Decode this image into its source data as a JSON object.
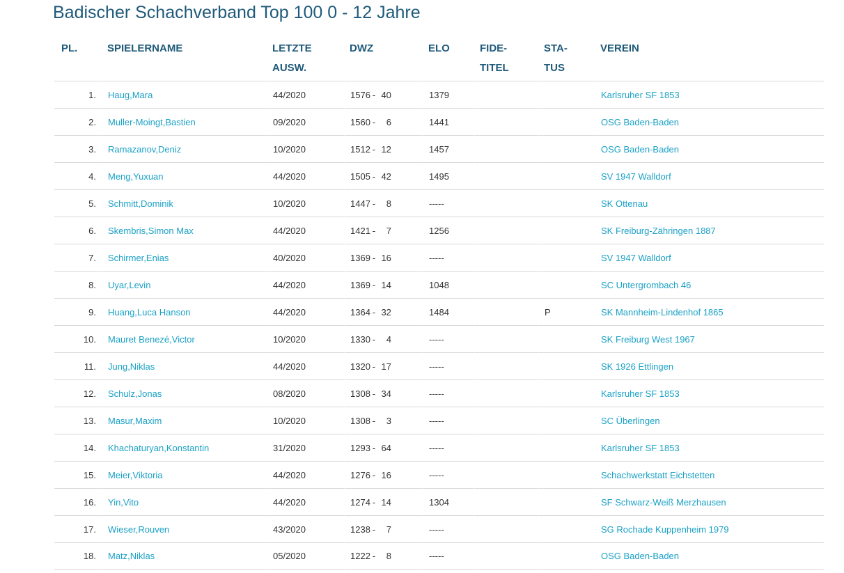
{
  "page": {
    "title": "Badischer Schachverband Top 100 0 - 12 Jahre"
  },
  "table": {
    "headers": {
      "pl": "PL.",
      "name": "SPIELERNAME",
      "auswertung_1": "LETZTE",
      "auswertung_2": "AUSW.",
      "dwz": "DWZ",
      "elo": "ELO",
      "fide_1": "FIDE-",
      "fide_2": "TITEL",
      "status_1": "STA-",
      "status_2": "TUS",
      "verein": "VEREIN"
    },
    "rows": [
      {
        "rank": "1.",
        "name": "Haug,Mara",
        "ausw": "44/2020",
        "dwz": "1576",
        "sep": "-",
        "count": "40",
        "elo": "1379",
        "fide": "",
        "status": "",
        "club": "Karlsruher SF 1853"
      },
      {
        "rank": "2.",
        "name": "Muller-Moingt,Bastien",
        "ausw": "09/2020",
        "dwz": "1560",
        "sep": "-",
        "count": "6",
        "elo": "1441",
        "fide": "",
        "status": "",
        "club": "OSG Baden-Baden"
      },
      {
        "rank": "3.",
        "name": "Ramazanov,Deniz",
        "ausw": "10/2020",
        "dwz": "1512",
        "sep": "-",
        "count": "12",
        "elo": "1457",
        "fide": "",
        "status": "",
        "club": "OSG Baden-Baden"
      },
      {
        "rank": "4.",
        "name": "Meng,Yuxuan",
        "ausw": "44/2020",
        "dwz": "1505",
        "sep": "-",
        "count": "42",
        "elo": "1495",
        "fide": "",
        "status": "",
        "club": "SV 1947 Walldorf"
      },
      {
        "rank": "5.",
        "name": "Schmitt,Dominik",
        "ausw": "10/2020",
        "dwz": "1447",
        "sep": "-",
        "count": "8",
        "elo": "-----",
        "fide": "",
        "status": "",
        "club": "SK Ottenau"
      },
      {
        "rank": "6.",
        "name": "Skembris,Simon Max",
        "ausw": "44/2020",
        "dwz": "1421",
        "sep": "-",
        "count": "7",
        "elo": "1256",
        "fide": "",
        "status": "",
        "club": "SK Freiburg-Zähringen 1887"
      },
      {
        "rank": "7.",
        "name": "Schirmer,Enias",
        "ausw": "40/2020",
        "dwz": "1369",
        "sep": "-",
        "count": "16",
        "elo": "-----",
        "fide": "",
        "status": "",
        "club": "SV 1947 Walldorf"
      },
      {
        "rank": "8.",
        "name": "Uyar,Levin",
        "ausw": "44/2020",
        "dwz": "1369",
        "sep": "-",
        "count": "14",
        "elo": "1048",
        "fide": "",
        "status": "",
        "club": "SC Untergrombach 46"
      },
      {
        "rank": "9.",
        "name": "Huang,Luca Hanson",
        "ausw": "44/2020",
        "dwz": "1364",
        "sep": "-",
        "count": "32",
        "elo": "1484",
        "fide": "",
        "status": "P",
        "club": "SK Mannheim-Lindenhof 1865"
      },
      {
        "rank": "10.",
        "name": "Mauret Benezé,Victor",
        "ausw": "10/2020",
        "dwz": "1330",
        "sep": "-",
        "count": "4",
        "elo": "-----",
        "fide": "",
        "status": "",
        "club": "SK Freiburg West 1967"
      },
      {
        "rank": "11.",
        "name": "Jung,Niklas",
        "ausw": "44/2020",
        "dwz": "1320",
        "sep": "-",
        "count": "17",
        "elo": "-----",
        "fide": "",
        "status": "",
        "club": "SK 1926 Ettlingen"
      },
      {
        "rank": "12.",
        "name": "Schulz,Jonas",
        "ausw": "08/2020",
        "dwz": "1308",
        "sep": "-",
        "count": "34",
        "elo": "-----",
        "fide": "",
        "status": "",
        "club": "Karlsruher SF 1853"
      },
      {
        "rank": "13.",
        "name": "Masur,Maxim",
        "ausw": "10/2020",
        "dwz": "1308",
        "sep": "-",
        "count": "3",
        "elo": "-----",
        "fide": "",
        "status": "",
        "club": "SC Überlingen"
      },
      {
        "rank": "14.",
        "name": "Khachaturyan,Konstantin",
        "ausw": "31/2020",
        "dwz": "1293",
        "sep": "-",
        "count": "64",
        "elo": "-----",
        "fide": "",
        "status": "",
        "club": "Karlsruher SF 1853"
      },
      {
        "rank": "15.",
        "name": "Meier,Viktoria",
        "ausw": "44/2020",
        "dwz": "1276",
        "sep": "-",
        "count": "16",
        "elo": "-----",
        "fide": "",
        "status": "",
        "club": "Schachwerkstatt Eichstetten"
      },
      {
        "rank": "16.",
        "name": "Yin,Vito",
        "ausw": "44/2020",
        "dwz": "1274",
        "sep": "-",
        "count": "14",
        "elo": "1304",
        "fide": "",
        "status": "",
        "club": "SF Schwarz-Weiß Merzhausen"
      },
      {
        "rank": "17.",
        "name": "Wieser,Rouven",
        "ausw": "43/2020",
        "dwz": "1238",
        "sep": "-",
        "count": "7",
        "elo": "-----",
        "fide": "",
        "status": "",
        "club": "SG Rochade Kuppenheim 1979"
      },
      {
        "rank": "18.",
        "name": "Matz,Niklas",
        "ausw": "05/2020",
        "dwz": "1222",
        "sep": "-",
        "count": "8",
        "elo": "-----",
        "fide": "",
        "status": "",
        "club": "OSG Baden-Baden"
      }
    ]
  },
  "colors": {
    "heading": "#1f5a7a",
    "link": "#1ba1c6",
    "text": "#333333",
    "row_border": "#d8d8d8"
  }
}
